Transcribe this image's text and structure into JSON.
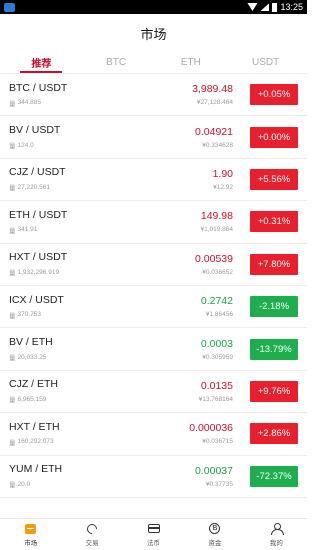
{
  "status_bar": {
    "time": "13:25",
    "app_icon": "app-icon",
    "wifi_icon": "wifi-icon",
    "signal_icon": "signal-icon",
    "battery_icon": "battery-icon"
  },
  "header": {
    "title": "市场"
  },
  "tabs": [
    {
      "label": "推荐",
      "active": true
    },
    {
      "label": "BTC",
      "active": false
    },
    {
      "label": "ETH",
      "active": false
    },
    {
      "label": "USDT",
      "active": false
    }
  ],
  "colors": {
    "up": "#e8202e",
    "down": "#1eae4e",
    "accent": "#c8102e",
    "nav_active": "#f39c12"
  },
  "volume_icon": "volume-icon",
  "rows": [
    {
      "pair": "BTC / USDT",
      "volume": "344.885",
      "price": "3,989.48",
      "cny": "¥27,128.464",
      "change": "+0.05%",
      "trend": "up"
    },
    {
      "pair": "BV / USDT",
      "volume": "124.0",
      "price": "0.04921",
      "cny": "¥0.334628",
      "change": "+0.00%",
      "trend": "up"
    },
    {
      "pair": "CJZ / USDT",
      "volume": "27,220.561",
      "price": "1.90",
      "cny": "¥12.92",
      "change": "+5.56%",
      "trend": "up"
    },
    {
      "pair": "ETH / USDT",
      "volume": "341.91",
      "price": "149.98",
      "cny": "¥1,019.864",
      "change": "+0.31%",
      "trend": "up"
    },
    {
      "pair": "HXT / USDT",
      "volume": "1,932,296.919",
      "price": "0.00539",
      "cny": "¥0.036652",
      "change": "+7.80%",
      "trend": "up"
    },
    {
      "pair": "ICX / USDT",
      "volume": "370.753",
      "price": "0.2742",
      "cny": "¥1.86456",
      "change": "-2.18%",
      "trend": "down"
    },
    {
      "pair": "BV / ETH",
      "volume": "20,033.25",
      "price": "0.0003",
      "cny": "¥0.305959",
      "change": "-13.79%",
      "trend": "down"
    },
    {
      "pair": "CJZ / ETH",
      "volume": "6,965.159",
      "price": "0.0135",
      "cny": "¥13.768164",
      "change": "+9.76%",
      "trend": "up"
    },
    {
      "pair": "HXT / ETH",
      "volume": "160,292.073",
      "price": "0.000036",
      "cny": "¥0.036715",
      "change": "+2.86%",
      "trend": "up"
    },
    {
      "pair": "YUM / ETH",
      "volume": "20.0",
      "price": "0.00037",
      "cny": "¥0.37735",
      "change": "-72.37%",
      "trend": "down"
    }
  ],
  "bottom_nav": [
    {
      "label": "市场",
      "icon": "market-icon",
      "active": true
    },
    {
      "label": "交易",
      "icon": "trade-icon",
      "active": false
    },
    {
      "label": "法币",
      "icon": "otc-icon",
      "active": false
    },
    {
      "label": "资金",
      "icon": "assets-icon",
      "active": false
    },
    {
      "label": "我的",
      "icon": "profile-icon",
      "active": false
    }
  ]
}
